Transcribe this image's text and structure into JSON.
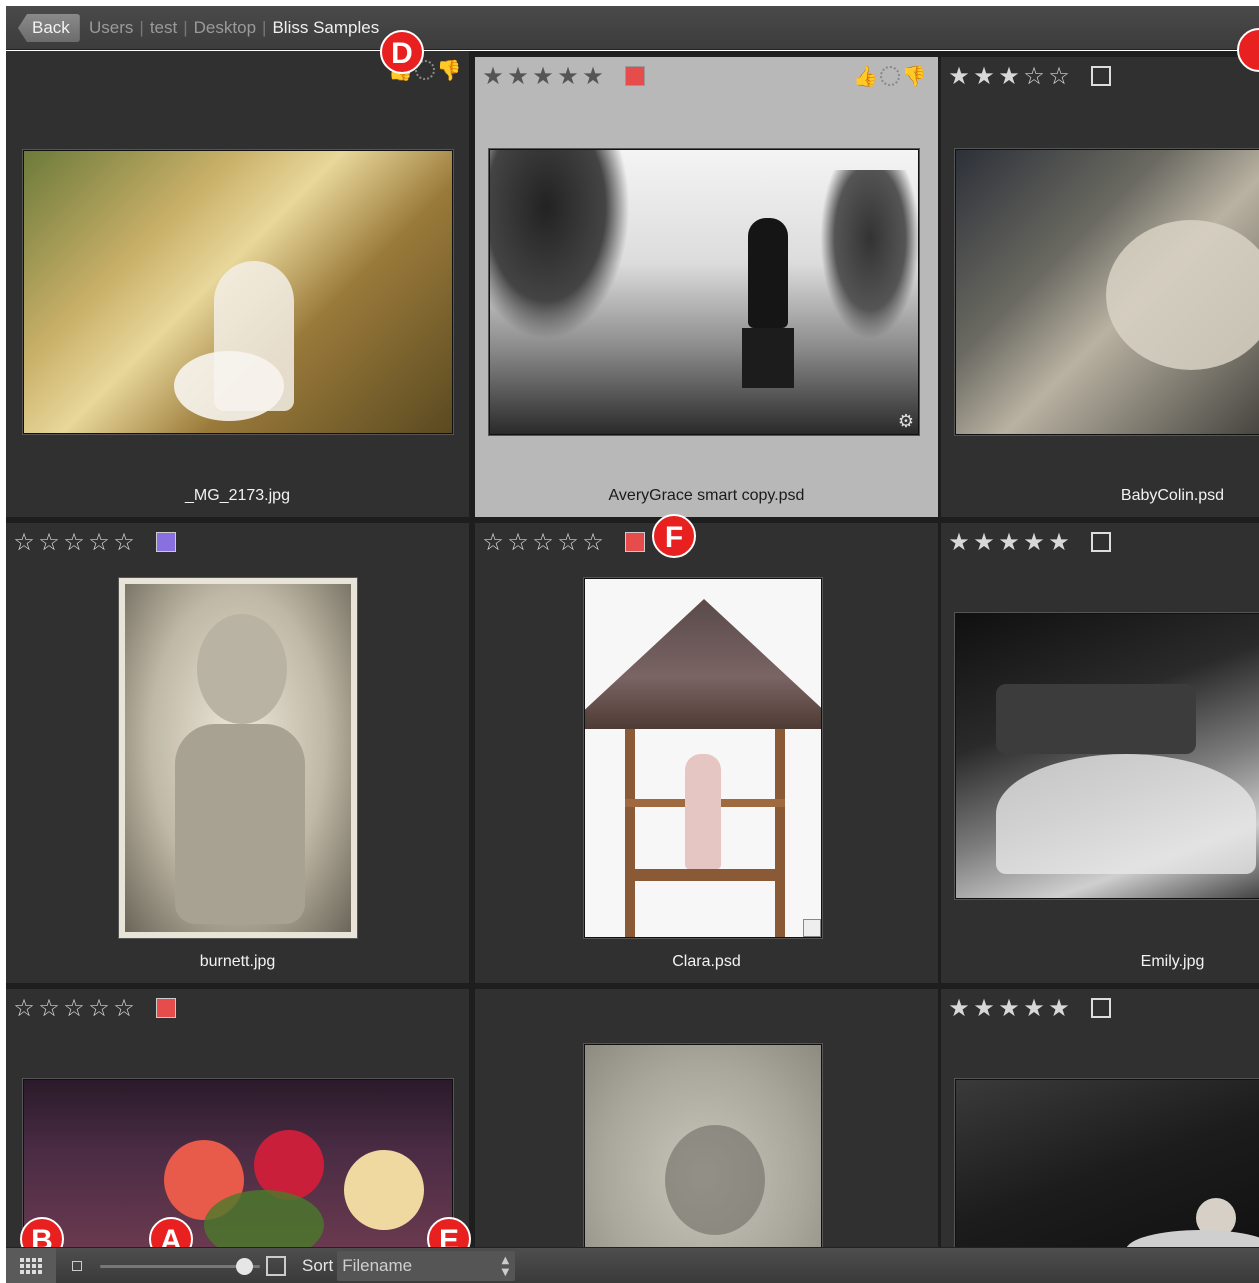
{
  "breadcrumb": {
    "back_label": "Back",
    "items": [
      "Users",
      "test",
      "Desktop",
      "Bliss Samples"
    ]
  },
  "icons": {
    "star_filled": "★",
    "star_empty": "☆",
    "thumbs_up": "👍",
    "thumbs_down": "👎",
    "gear": "⚙"
  },
  "grid": {
    "cells": [
      {
        "filename": "_MG_2173.jpg",
        "rating": null,
        "color_label": null,
        "votes_visible": true,
        "selected": false
      },
      {
        "filename": "AveryGrace smart copy.psd",
        "rating": 5,
        "color_label": "#e74c4c",
        "votes_visible": true,
        "selected": true
      },
      {
        "filename": "BabyColin.psd",
        "rating": 3,
        "color_label": null,
        "votes_visible": false,
        "selected": false
      },
      {
        "filename": "burnett.jpg",
        "rating": 0,
        "color_label": "#8a6fe0",
        "votes_visible": false,
        "selected": false
      },
      {
        "filename": "Clara.psd",
        "rating": 0,
        "color_label": "#e74c4c",
        "votes_visible": false,
        "selected": false
      },
      {
        "filename": "Emily.jpg",
        "rating": 5,
        "color_label": null,
        "votes_visible": false,
        "selected": false
      },
      {
        "filename": "",
        "rating": 0,
        "color_label": "#e74c4c",
        "votes_visible": false,
        "selected": false
      },
      {
        "filename": "",
        "rating": null,
        "color_label": null,
        "votes_visible": false,
        "selected": false
      },
      {
        "filename": "",
        "rating": 5,
        "color_label": null,
        "votes_visible": false,
        "selected": false
      }
    ]
  },
  "markers": {
    "a": "A",
    "b": "B",
    "d": "D",
    "e": "E",
    "f": "F"
  },
  "toolbar": {
    "sort_label": "Sort",
    "sort_value": "Filename",
    "thumbnail_size": 0.9
  }
}
